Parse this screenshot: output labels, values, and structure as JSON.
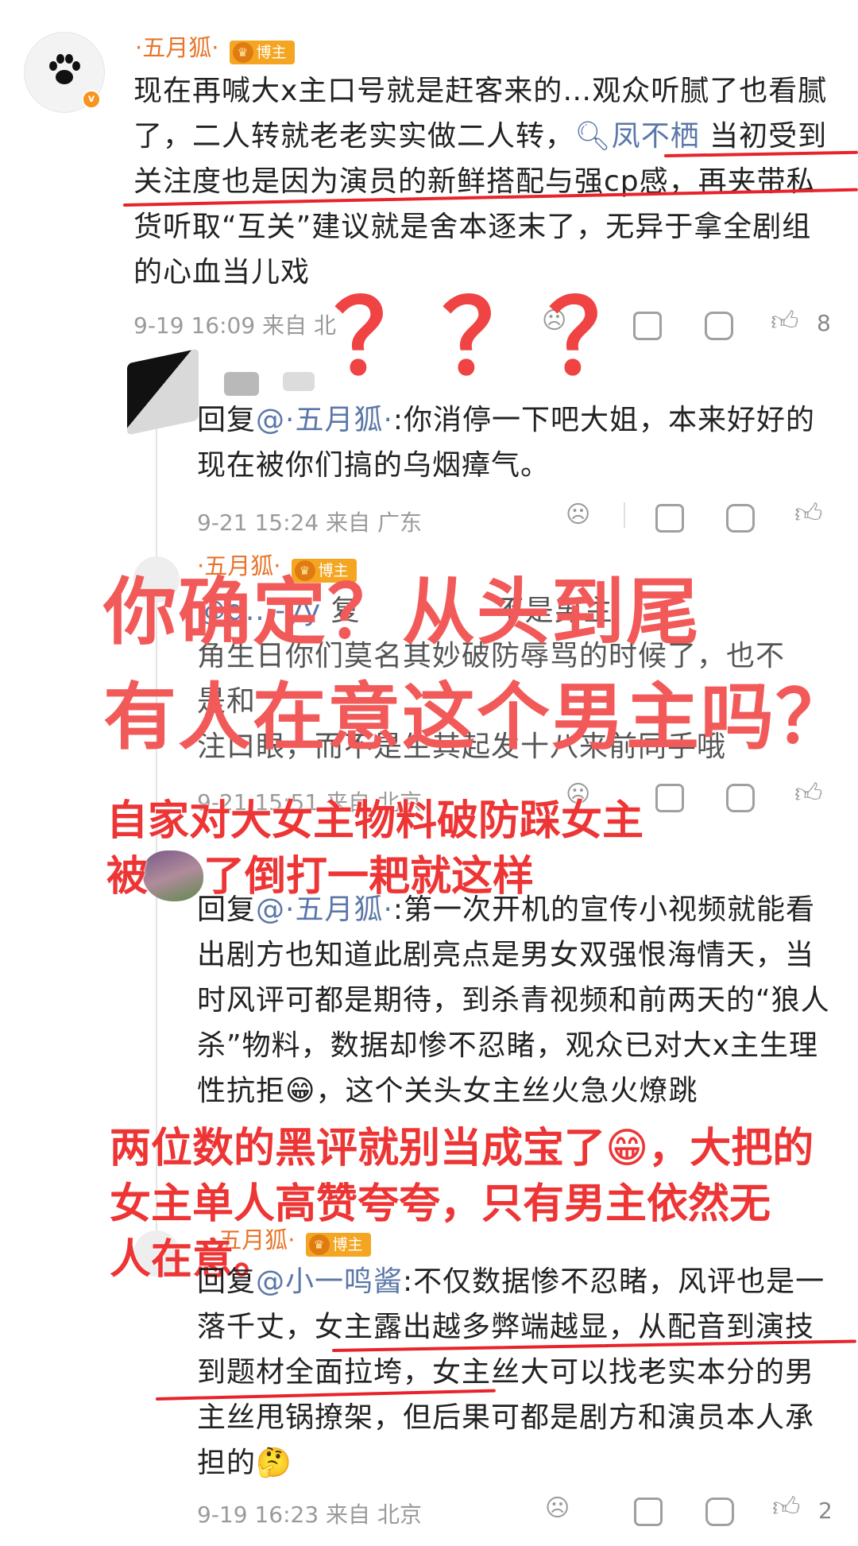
{
  "main_comment": {
    "author": "·五月狐·",
    "badge": "博主",
    "text_parts": [
      "现在再喊大x主口号就是赶客来的…观众听腻了也看腻了，二人转就老老实实做二人转，",
      "凤不栖",
      " 当初受到关注度也是因为演员的新鲜搭配与强cp感，再夹带私货听取“互关”建议就是舍本逐末了，无异于拿全剧组的心血当儿戏"
    ],
    "meta": "9-19 16:09  来自 北",
    "like_count": "8"
  },
  "reply1": {
    "prefix": "回复",
    "mention": "@·五月狐·",
    "text": ":你消停一下吧大姐，本来好好的现在被你们搞的乌烟瘴气。",
    "meta": "9-21 15:24  来自 广东"
  },
  "reply2": {
    "author": "·五月狐·",
    "badge": "博主",
    "mention": "@g...-yy",
    "line1": "复",
    "line1_tail": "不是男主",
    "line2": "角生日你们莫名其妙破防辱骂的时候了，也不",
    "line3": "是和",
    "line4": "注口眼，而不是生其起发十八来前同手哦",
    "meta": "9-21 15:51  来自 北京"
  },
  "reply3": {
    "prefix": "回复",
    "mention": "@·五月狐·",
    "text": ":第一次开机的宣传小视频就能看出剧方也知道此剧亮点是男女双强恨海情天，当时风评可都是期待，到杀青视频和前两天的“狼人杀”物料，数据却惨不忍睹，观众已对大x主生理性抗拒😁，这个关头女主丝火急火燎跳"
  },
  "reply4": {
    "author": "·五月狐·",
    "badge": "博主",
    "prefix": "回复",
    "mention": "@小一鸣酱",
    "text": ":不仅数据惨不忍睹，风评也是一落千丈，女主露出越多弊端越显，从配音到演技到题材全面拉垮，女主丝大可以找老实本分的男主丝甩锅撩架，但后果可都是剧方和演员本人承担的🤔",
    "meta": "9-19 16:23  来自 北京",
    "like_count": "2"
  },
  "overlays": {
    "question_marks": [
      "？",
      "？",
      "？"
    ],
    "big_line1": "你确定？从头到尾",
    "big_line2": "有人在意这个男主吗？",
    "mid1_line1": "自家对大女主物料破防踩女主",
    "mid1_line2": "被",
    "mid1_line2_tail": "了倒打一耙就这样",
    "mid2_line1": "两位数的黑评就别当成宝了😁，大把的",
    "mid2_line2": "女主单人高赞夸夸，只有男主依然无",
    "mid2_line3": "人在意。"
  },
  "colors": {
    "username": "#e8742a",
    "mention": "#5b77a8",
    "overlay_red": "#ee3b3b",
    "underline": "#e8232b",
    "meta_gray": "#9a9a9a"
  }
}
